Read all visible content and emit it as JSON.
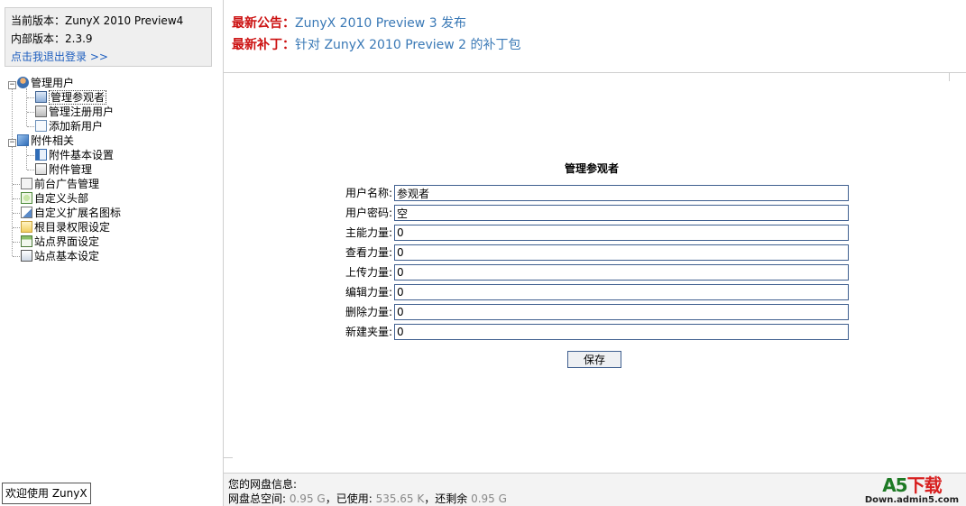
{
  "version": {
    "current_label": "当前版本：ZunyX 2010 Preview4",
    "internal_label": "内部版本：2.3.9",
    "logout_link": "点击我退出登录 >>"
  },
  "tree": {
    "group_users": "管理用户",
    "manage_guests": "管理参观者",
    "manage_registered": "管理注册用户",
    "add_user": "添加新用户",
    "group_attachments": "附件相关",
    "attachment_settings": "附件基本设置",
    "attachment_manage": "附件管理",
    "ad_manage": "前台广告管理",
    "custom_header": "自定义头部",
    "custom_ext_icons": "自定义扩展名图标",
    "root_permissions": "根目录权限设定",
    "site_ui": "站点界面设定",
    "site_basic": "站点基本设定"
  },
  "welcome": "欢迎使用 ZunyX",
  "notices": {
    "announcement_key": "最新公告：",
    "announcement_value": "ZunyX 2010 Preview 3 发布",
    "patch_key": "最新补丁：",
    "patch_value": "针对 ZunyX 2010 Preview 2 的补丁包"
  },
  "form": {
    "title": "管理参观者",
    "fields": [
      {
        "label": "用户名称:",
        "value": "参观者"
      },
      {
        "label": "用户密码:",
        "value": "空"
      },
      {
        "label": "主能力量:",
        "value": "0"
      },
      {
        "label": "查看力量:",
        "value": "0"
      },
      {
        "label": "上传力量:",
        "value": "0"
      },
      {
        "label": "编辑力量:",
        "value": "0"
      },
      {
        "label": "删除力量:",
        "value": "0"
      },
      {
        "label": "新建夹量:",
        "value": "0"
      }
    ],
    "save_label": "保存"
  },
  "footer": {
    "disk_title": "您的网盘信息:",
    "total_label": "网盘总空间: ",
    "total_value": "0.95 G",
    "used_label": "，已使用: ",
    "used_value": "535.65 K",
    "remaining_label": "，还剩余 ",
    "remaining_value": "0.95 G",
    "logo_main": "A5",
    "logo_dl": "下载",
    "logo_sub": "Down.admin5.com"
  },
  "colors": {
    "notice_key": "#cc1111",
    "notice_value": "#3a79b6",
    "link": "#1f5fbf",
    "input_border": "#3f5f8f"
  }
}
